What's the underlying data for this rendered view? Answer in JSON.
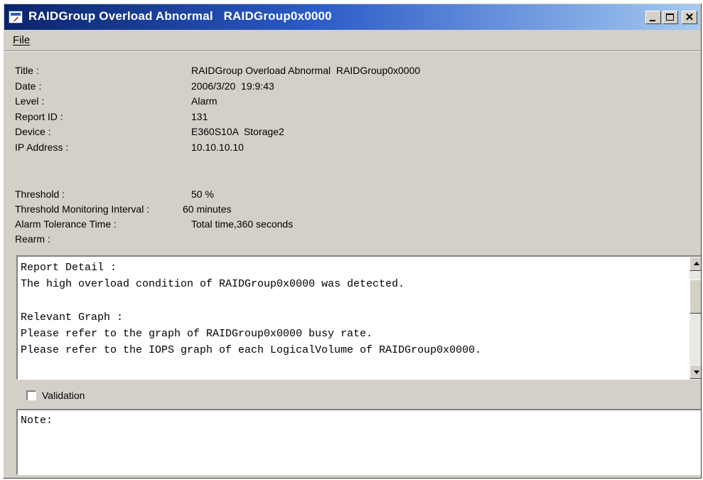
{
  "window": {
    "title": "RAIDGroup Overload Abnormal   RAIDGroup0x0000",
    "minimize_icon": "minimize-icon",
    "maximize_icon": "maximize-icon",
    "close_icon": "close-icon",
    "close_glyph": "✕",
    "app_icon": "report-window-icon"
  },
  "menu": {
    "file_label": "File"
  },
  "info": {
    "rows": [
      {
        "label": "Title :",
        "value": "RAIDGroup Overload Abnormal  RAIDGroup0x0000"
      },
      {
        "label": "Date :",
        "value": "2006/3/20  19:9:43"
      },
      {
        "label": "Level :",
        "value": "Alarm"
      },
      {
        "label": "Report ID :",
        "value": "131"
      },
      {
        "label": "Device :",
        "value": "E360S10A  Storage2"
      },
      {
        "label": "IP Address :",
        "value": "10.10.10.10"
      }
    ],
    "threshold_rows": [
      {
        "label": "Threshold :",
        "value": "50 %"
      },
      {
        "label": "Threshold Monitoring Interval :",
        "value": "60 minutes"
      },
      {
        "label": "Alarm Tolerance Time :",
        "value": "Total time,360 seconds"
      },
      {
        "label": "Rearm :",
        "value": ""
      }
    ]
  },
  "detail": {
    "lines": [
      "Report Detail :",
      "The high overload condition of RAIDGroup0x0000 was detected.",
      "",
      "Relevant Graph :",
      "Please refer to the graph of RAIDGroup0x0000 busy rate.",
      "Please refer to the IOPS graph of each LogicalVolume of RAIDGroup0x0000."
    ]
  },
  "validation": {
    "label": "Validation",
    "checked": false
  },
  "note": {
    "text": "Note:"
  }
}
